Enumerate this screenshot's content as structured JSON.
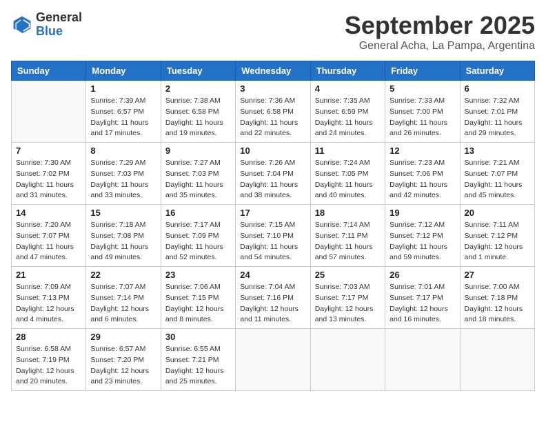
{
  "header": {
    "logo_general": "General",
    "logo_blue": "Blue",
    "month_title": "September 2025",
    "location": "General Acha, La Pampa, Argentina"
  },
  "weekdays": [
    "Sunday",
    "Monday",
    "Tuesday",
    "Wednesday",
    "Thursday",
    "Friday",
    "Saturday"
  ],
  "weeks": [
    [
      {
        "day": "",
        "info": ""
      },
      {
        "day": "1",
        "info": "Sunrise: 7:39 AM\nSunset: 6:57 PM\nDaylight: 11 hours\nand 17 minutes."
      },
      {
        "day": "2",
        "info": "Sunrise: 7:38 AM\nSunset: 6:58 PM\nDaylight: 11 hours\nand 19 minutes."
      },
      {
        "day": "3",
        "info": "Sunrise: 7:36 AM\nSunset: 6:58 PM\nDaylight: 11 hours\nand 22 minutes."
      },
      {
        "day": "4",
        "info": "Sunrise: 7:35 AM\nSunset: 6:59 PM\nDaylight: 11 hours\nand 24 minutes."
      },
      {
        "day": "5",
        "info": "Sunrise: 7:33 AM\nSunset: 7:00 PM\nDaylight: 11 hours\nand 26 minutes."
      },
      {
        "day": "6",
        "info": "Sunrise: 7:32 AM\nSunset: 7:01 PM\nDaylight: 11 hours\nand 29 minutes."
      }
    ],
    [
      {
        "day": "7",
        "info": "Sunrise: 7:30 AM\nSunset: 7:02 PM\nDaylight: 11 hours\nand 31 minutes."
      },
      {
        "day": "8",
        "info": "Sunrise: 7:29 AM\nSunset: 7:03 PM\nDaylight: 11 hours\nand 33 minutes."
      },
      {
        "day": "9",
        "info": "Sunrise: 7:27 AM\nSunset: 7:03 PM\nDaylight: 11 hours\nand 35 minutes."
      },
      {
        "day": "10",
        "info": "Sunrise: 7:26 AM\nSunset: 7:04 PM\nDaylight: 11 hours\nand 38 minutes."
      },
      {
        "day": "11",
        "info": "Sunrise: 7:24 AM\nSunset: 7:05 PM\nDaylight: 11 hours\nand 40 minutes."
      },
      {
        "day": "12",
        "info": "Sunrise: 7:23 AM\nSunset: 7:06 PM\nDaylight: 11 hours\nand 42 minutes."
      },
      {
        "day": "13",
        "info": "Sunrise: 7:21 AM\nSunset: 7:07 PM\nDaylight: 11 hours\nand 45 minutes."
      }
    ],
    [
      {
        "day": "14",
        "info": "Sunrise: 7:20 AM\nSunset: 7:07 PM\nDaylight: 11 hours\nand 47 minutes."
      },
      {
        "day": "15",
        "info": "Sunrise: 7:18 AM\nSunset: 7:08 PM\nDaylight: 11 hours\nand 49 minutes."
      },
      {
        "day": "16",
        "info": "Sunrise: 7:17 AM\nSunset: 7:09 PM\nDaylight: 11 hours\nand 52 minutes."
      },
      {
        "day": "17",
        "info": "Sunrise: 7:15 AM\nSunset: 7:10 PM\nDaylight: 11 hours\nand 54 minutes."
      },
      {
        "day": "18",
        "info": "Sunrise: 7:14 AM\nSunset: 7:11 PM\nDaylight: 11 hours\nand 57 minutes."
      },
      {
        "day": "19",
        "info": "Sunrise: 7:12 AM\nSunset: 7:12 PM\nDaylight: 11 hours\nand 59 minutes."
      },
      {
        "day": "20",
        "info": "Sunrise: 7:11 AM\nSunset: 7:12 PM\nDaylight: 12 hours\nand 1 minute."
      }
    ],
    [
      {
        "day": "21",
        "info": "Sunrise: 7:09 AM\nSunset: 7:13 PM\nDaylight: 12 hours\nand 4 minutes."
      },
      {
        "day": "22",
        "info": "Sunrise: 7:07 AM\nSunset: 7:14 PM\nDaylight: 12 hours\nand 6 minutes."
      },
      {
        "day": "23",
        "info": "Sunrise: 7:06 AM\nSunset: 7:15 PM\nDaylight: 12 hours\nand 8 minutes."
      },
      {
        "day": "24",
        "info": "Sunrise: 7:04 AM\nSunset: 7:16 PM\nDaylight: 12 hours\nand 11 minutes."
      },
      {
        "day": "25",
        "info": "Sunrise: 7:03 AM\nSunset: 7:17 PM\nDaylight: 12 hours\nand 13 minutes."
      },
      {
        "day": "26",
        "info": "Sunrise: 7:01 AM\nSunset: 7:17 PM\nDaylight: 12 hours\nand 16 minutes."
      },
      {
        "day": "27",
        "info": "Sunrise: 7:00 AM\nSunset: 7:18 PM\nDaylight: 12 hours\nand 18 minutes."
      }
    ],
    [
      {
        "day": "28",
        "info": "Sunrise: 6:58 AM\nSunset: 7:19 PM\nDaylight: 12 hours\nand 20 minutes."
      },
      {
        "day": "29",
        "info": "Sunrise: 6:57 AM\nSunset: 7:20 PM\nDaylight: 12 hours\nand 23 minutes."
      },
      {
        "day": "30",
        "info": "Sunrise: 6:55 AM\nSunset: 7:21 PM\nDaylight: 12 hours\nand 25 minutes."
      },
      {
        "day": "",
        "info": ""
      },
      {
        "day": "",
        "info": ""
      },
      {
        "day": "",
        "info": ""
      },
      {
        "day": "",
        "info": ""
      }
    ]
  ]
}
